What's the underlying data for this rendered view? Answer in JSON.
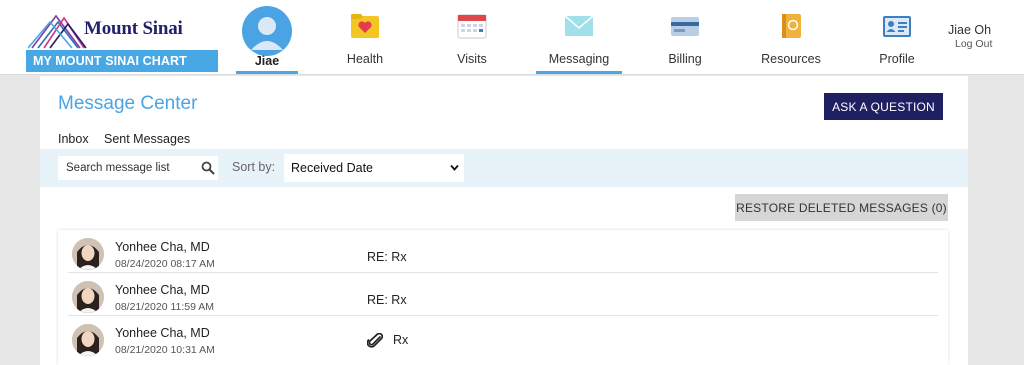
{
  "brand": {
    "logo_text": "Mount Sinai",
    "chart_banner": "MY MOUNT SINAI CHART",
    "accent": "#47a8e5",
    "navy": "#1f2062"
  },
  "nav": {
    "user_tab": "Jiae",
    "items": [
      {
        "label": "Health",
        "icon": "heart-folder-icon"
      },
      {
        "label": "Visits",
        "icon": "calendar-icon"
      },
      {
        "label": "Messaging",
        "icon": "envelope-icon",
        "active": true
      },
      {
        "label": "Billing",
        "icon": "credit-card-icon"
      },
      {
        "label": "Resources",
        "icon": "book-icon"
      },
      {
        "label": "Profile",
        "icon": "id-card-icon"
      }
    ]
  },
  "account": {
    "name": "Jiae Oh",
    "logout": "Log Out"
  },
  "page": {
    "title": "Message Center",
    "ask_button": "ASK A QUESTION",
    "tabs": [
      {
        "label": "Inbox",
        "active": true
      },
      {
        "label": "Sent Messages"
      }
    ],
    "search_placeholder": "Search message list",
    "sort_label": "Sort by:",
    "sort_value": "Received Date",
    "restore_button": "RESTORE DELETED MESSAGES (0)"
  },
  "messages": [
    {
      "sender": "Yonhee Cha, MD",
      "date": "08/24/2020 08:17 AM",
      "subject": "RE: Rx",
      "attachment": false
    },
    {
      "sender": "Yonhee Cha, MD",
      "date": "08/21/2020 11:59 AM",
      "subject": "RE: Rx",
      "attachment": false
    },
    {
      "sender": "Yonhee Cha, MD",
      "date": "08/21/2020 10:31 AM",
      "subject": "Rx",
      "attachment": true
    }
  ]
}
